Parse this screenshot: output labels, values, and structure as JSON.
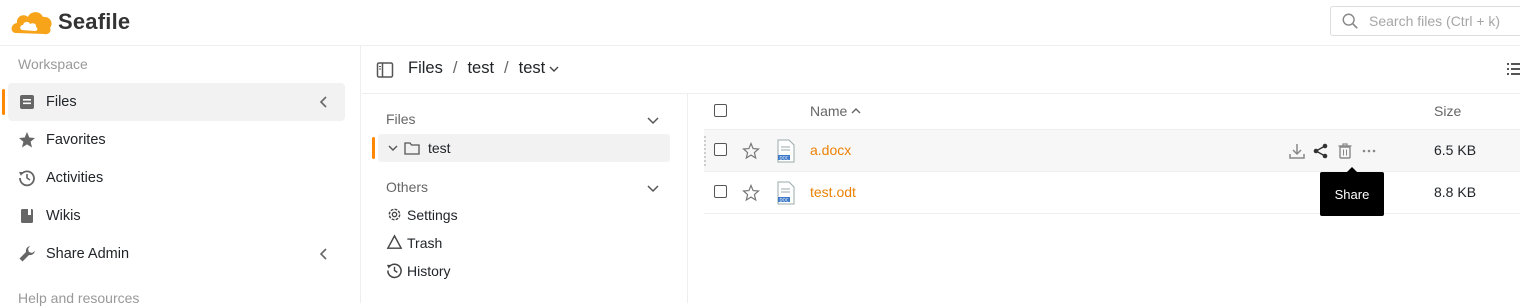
{
  "app": {
    "name": "Seafile"
  },
  "search": {
    "placeholder": "Search files (Ctrl + k)"
  },
  "sidebar": {
    "workspace_heading": "Workspace",
    "items": [
      {
        "label": "Files",
        "icon": "file-icon",
        "active": true
      },
      {
        "label": "Favorites",
        "icon": "star-icon"
      },
      {
        "label": "Activities",
        "icon": "history-icon"
      },
      {
        "label": "Wikis",
        "icon": "wiki-icon"
      },
      {
        "label": "Share Admin",
        "icon": "wrench-icon"
      }
    ],
    "help_heading": "Help and resources"
  },
  "breadcrumb": {
    "root": "Files",
    "sep": "/",
    "library": "test",
    "current": "test"
  },
  "tree": {
    "files_heading": "Files",
    "node": "test",
    "others_heading": "Others",
    "links": [
      {
        "label": "Settings",
        "icon": "gear-icon"
      },
      {
        "label": "Trash",
        "icon": "recycle-icon"
      },
      {
        "label": "History",
        "icon": "history-icon"
      }
    ]
  },
  "table": {
    "col_name": "Name",
    "col_size": "Size",
    "rows": [
      {
        "name": "a.docx",
        "size": "6.5 KB"
      },
      {
        "name": "test.odt",
        "size": "8.8 KB"
      }
    ]
  },
  "tooltip": {
    "text": "Share"
  },
  "colors": {
    "accent": "#ff8800",
    "link": "#eb8205"
  }
}
